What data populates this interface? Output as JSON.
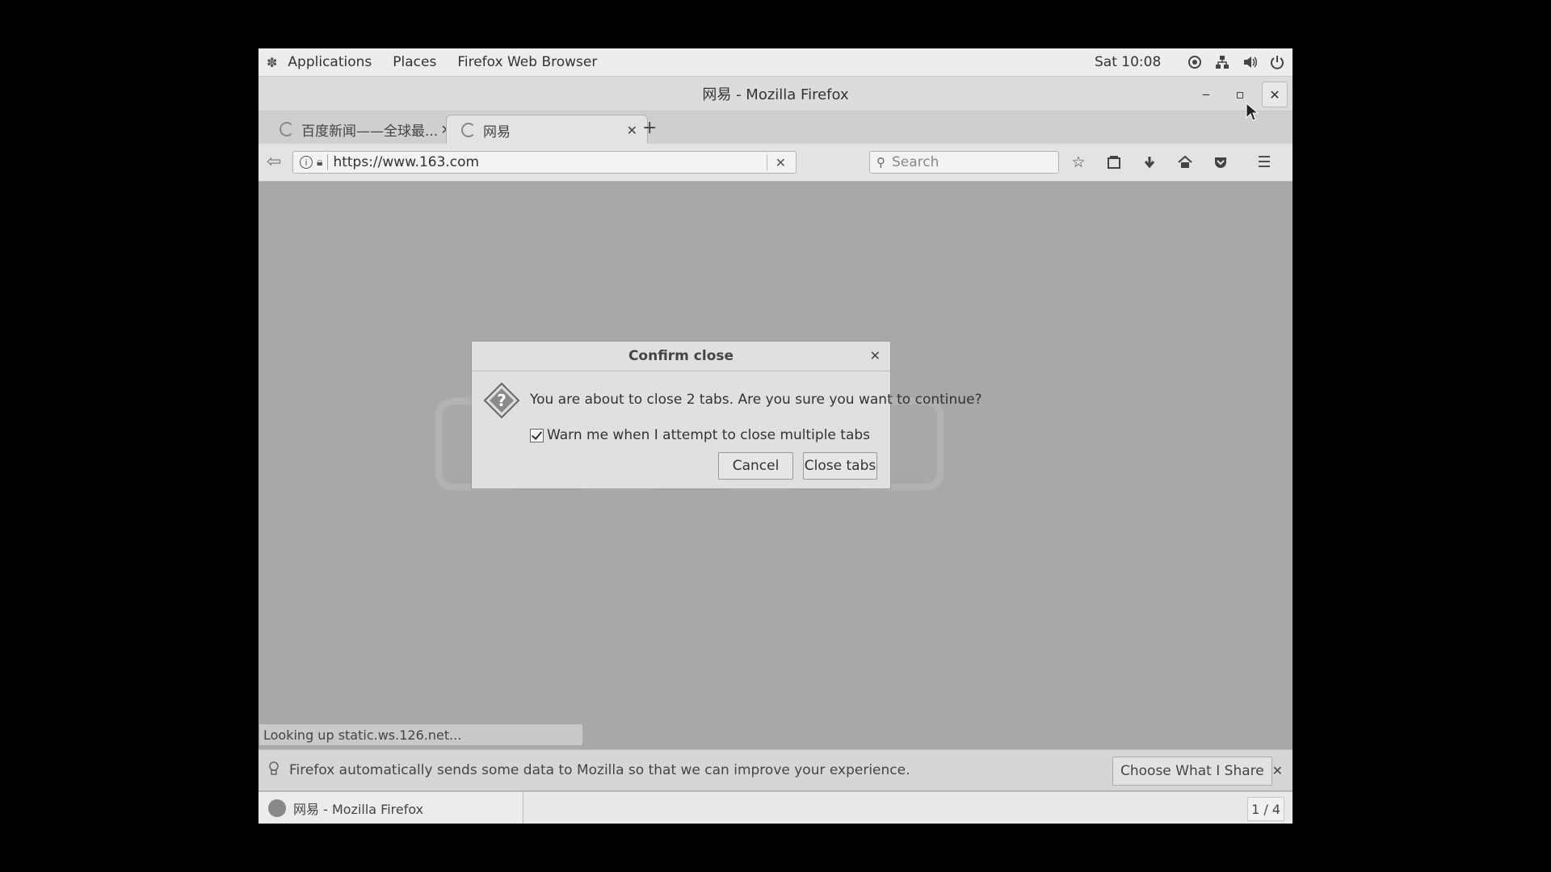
{
  "top_panel": {
    "applications": "Applications",
    "places": "Places",
    "app_name": "Firefox Web Browser",
    "clock": "Sat 10:08"
  },
  "window": {
    "title": "网易 - Mozilla Firefox"
  },
  "tabs": [
    {
      "label": "百度新闻——全球最..."
    },
    {
      "label": "网易"
    }
  ],
  "navbar": {
    "url": "https://www.163.com",
    "search_placeholder": "Search"
  },
  "status_text": "Looking up static.ws.126.net...",
  "notification": {
    "text": "Firefox automatically sends some data to Mozilla so that we can improve your experience.",
    "button": "Choose What I Share"
  },
  "taskbar": {
    "item_label": "网易 - Mozilla Firefox",
    "workspace": "1 / 4"
  },
  "dialog": {
    "title": "Confirm close",
    "message": "You are about to close 2 tabs. Are you sure you want to continue?",
    "checkbox_label": "Warn me when I attempt to close multiple tabs",
    "checkbox_checked": true,
    "cancel": "Cancel",
    "confirm": "Close tabs"
  }
}
